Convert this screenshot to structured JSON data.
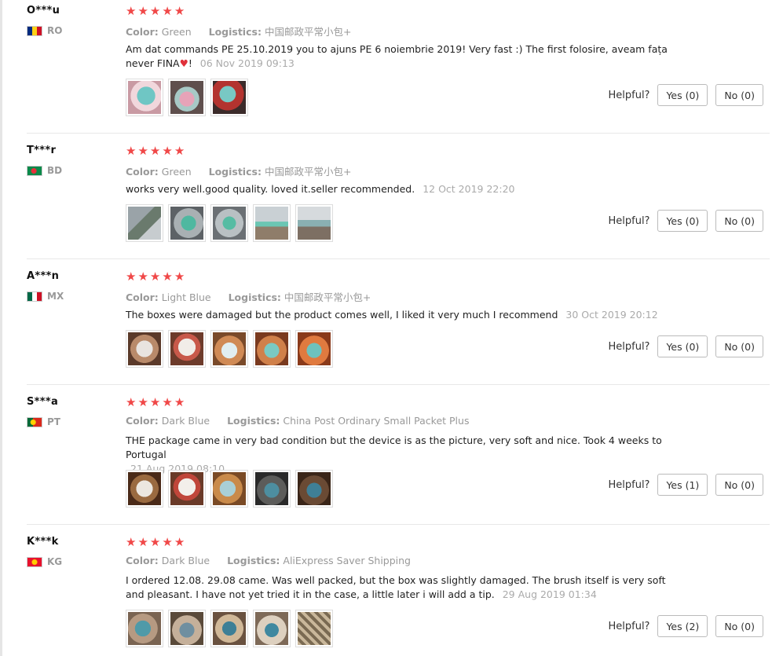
{
  "labels": {
    "color": "Color:",
    "logistics": "Logistics:",
    "helpful": "Helpful?"
  },
  "reviews": [
    {
      "user": "O***u",
      "country": "RO",
      "rating": 5,
      "color": "Green",
      "logistics": "中国邮政平常小包+",
      "text": "Am dat commands PE 25.10.2019 you to ajuns PE 6 noiembrie 2019! Very fast :) The first folosire, aveam fața never FINA",
      "date": "06 Nov 2019 09:13",
      "yes": "Yes (0)",
      "no": "No (0)"
    },
    {
      "user": "T***r",
      "country": "BD",
      "rating": 5,
      "color": "Green",
      "logistics": "中国邮政平常小包+",
      "text": "works very well.good quality. loved it.seller recommended.",
      "date": "12 Oct 2019 22:20",
      "yes": "Yes (0)",
      "no": "No (0)"
    },
    {
      "user": "A***n",
      "country": "MX",
      "rating": 5,
      "color": "Light Blue",
      "logistics": "中国邮政平常小包+",
      "text": "The boxes were damaged but the product comes well, I liked it very much I recommend",
      "date": "30 Oct 2019 20:12",
      "yes": "Yes (0)",
      "no": "No (0)"
    },
    {
      "user": "S***a",
      "country": "PT",
      "rating": 5,
      "color": "Dark Blue",
      "logistics": "China Post Ordinary Small Packet Plus",
      "text": "THE package came in very bad condition but the device is as the picture, very soft and nice. Took 4 weeks to Portugal",
      "date": "21 Aug 2019 08:10",
      "yes": "Yes (1)",
      "no": "No (0)"
    },
    {
      "user": "K***k",
      "country": "KG",
      "rating": 5,
      "color": "Dark Blue",
      "logistics": "AliExpress Saver Shipping",
      "text": "I ordered 12.08. 29.08 came. Was well packed, but the box was slightly damaged. The brush itself is very soft and pleasant. I have not yet tried it in the case, a little later i will add a tip.",
      "date": "29 Aug 2019 01:34",
      "yes": "Yes (2)",
      "no": "No (0)"
    }
  ]
}
